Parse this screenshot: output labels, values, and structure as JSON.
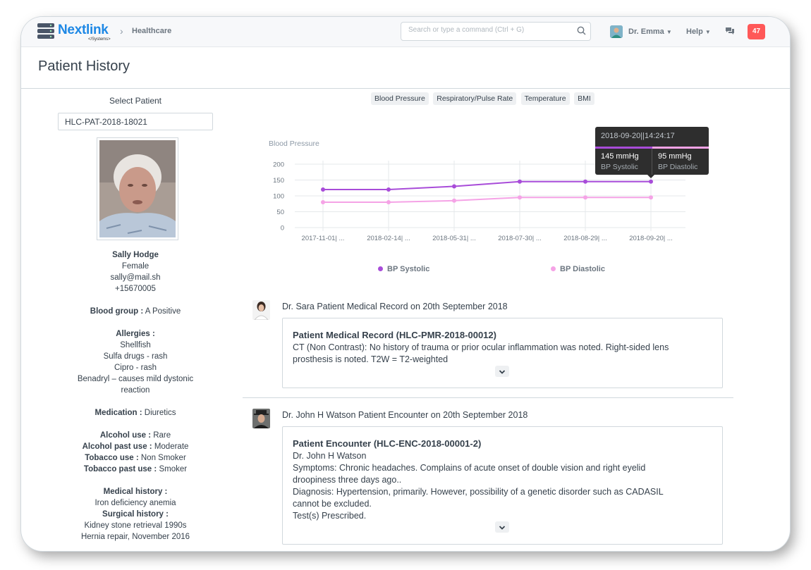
{
  "navbar": {
    "logo_word": "Nextlink",
    "logo_sub": "</Systems>",
    "breadcrumb": "Healthcare",
    "search_placeholder": "Search or type a command (Ctrl + G)",
    "user_name": "Dr. Emma",
    "help_label": "Help",
    "notification_count": "47"
  },
  "page": {
    "title": "Patient History"
  },
  "patient": {
    "select_label": "Select Patient",
    "id": "HLC-PAT-2018-18021",
    "name": "Sally Hodge",
    "gender": "Female",
    "email": "sally@mail.sh",
    "phone": "+15670005",
    "blood_group_label": "Blood group :",
    "blood_group": "A Positive",
    "allergies_label": "Allergies :",
    "allergies": [
      "Shellfish",
      "Sulfa drugs - rash",
      "Cipro - rash",
      "Benadryl – causes mild dystonic",
      "reaction"
    ],
    "medication_label": "Medication :",
    "medication": "Diuretics",
    "alcohol_use_label": "Alcohol use :",
    "alcohol_use": "Rare",
    "alcohol_past_label": "Alcohol past use :",
    "alcohol_past": "Moderate",
    "tobacco_use_label": "Tobacco use :",
    "tobacco_use": "Non Smoker",
    "tobacco_past_label": "Tobacco past use :",
    "tobacco_past": "Smoker",
    "medical_history_label": "Medical history :",
    "medical_history": "Iron deficiency anemia",
    "surgical_history_label": "Surgical history :",
    "surgical_history": [
      "Kidney stone retrieval 1990s",
      "Hernia repair, November 2016"
    ]
  },
  "chart_tabs": [
    "Blood Pressure",
    "Respiratory/Pulse Rate",
    "Temperature",
    "BMI"
  ],
  "chart_data": {
    "type": "line",
    "title": "Blood Pressure",
    "categories": [
      "2017-11-01| ...",
      "2018-02-14| ...",
      "2018-05-31| ...",
      "2018-07-30| ...",
      "2018-08-29| ...",
      "2018-09-20| ..."
    ],
    "series": [
      {
        "name": "BP Systolic",
        "values": [
          120,
          120,
          130,
          145,
          145,
          145
        ],
        "color": "#a84cd9"
      },
      {
        "name": "BP Diastolic",
        "values": [
          80,
          80,
          85,
          95,
          95,
          95
        ],
        "color": "#f5a3e6"
      }
    ],
    "y_ticks": [
      "0",
      "50",
      "100",
      "150",
      "200"
    ],
    "ylim": [
      0,
      200
    ],
    "grid": true,
    "legend": "bottom"
  },
  "tooltip": {
    "title": "2018-09-20||14:24:17",
    "systolic_value": "145 mmHg",
    "systolic_label": "BP Systolic",
    "diastolic_value": "95 mmHg",
    "diastolic_label": "BP Diastolic"
  },
  "timeline": [
    {
      "heading": "Dr. Sara Patient Medical Record on 20th September 2018",
      "card_title": "Patient Medical Record (HLC-PMR-2018-00012)",
      "lines": [
        "CT (Non Contrast): No history of trauma or prior ocular inflammation was noted. Right-sided lens",
        "prosthesis is noted. T2W = T2-weighted"
      ]
    },
    {
      "heading": "Dr. John H Watson Patient Encounter on 20th September 2018",
      "card_title": "Patient Encounter (HLC-ENC-2018-00001-2)",
      "lines": [
        "Dr. John H Watson",
        "Symptoms: Chronic headaches. Complains of acute onset of double vision and right eyelid",
        "droopiness three days ago..",
        "Diagnosis: Hypertension, primarily. However, possibility of a genetic disorder such as CADASIL",
        "cannot be excluded.",
        "Test(s) Prescribed."
      ]
    }
  ]
}
